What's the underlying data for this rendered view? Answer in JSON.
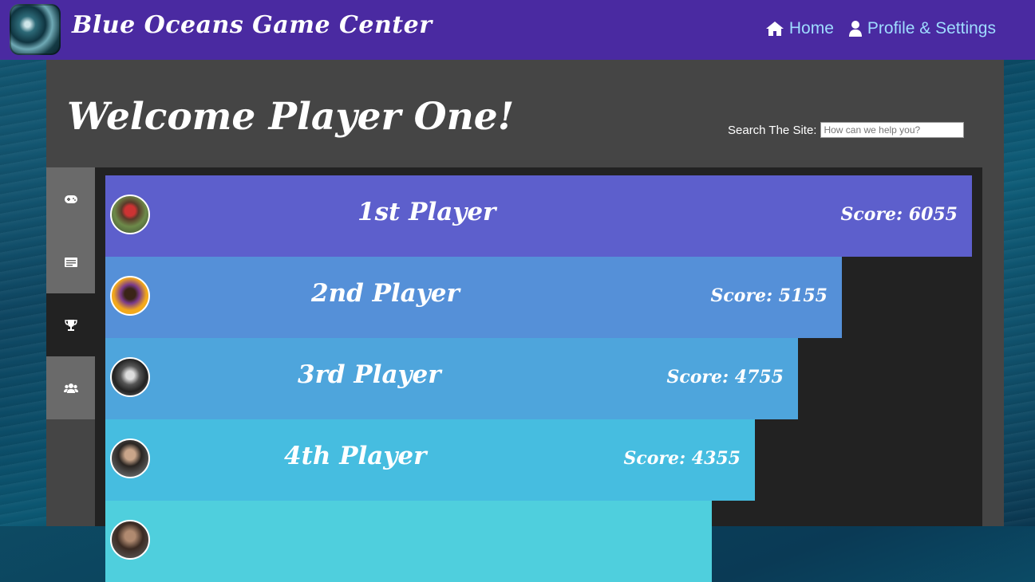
{
  "header": {
    "site_title": "Blue Oceans Game Center",
    "nav": [
      {
        "label": "Home",
        "icon": "home-icon"
      },
      {
        "label": "Profile & Settings",
        "icon": "user-icon"
      }
    ]
  },
  "main": {
    "welcome": "Welcome Player One!",
    "search_label": "Search The Site:",
    "search_placeholder": "How can we help you?"
  },
  "sidebar": {
    "items": [
      {
        "icon": "gamepad-icon",
        "active": false
      },
      {
        "icon": "news-icon",
        "active": false
      },
      {
        "icon": "trophy-icon",
        "active": true
      },
      {
        "icon": "users-icon",
        "active": false
      }
    ]
  },
  "leaderboard": {
    "rows": [
      {
        "name": "1st Player",
        "score": "Score: 6055",
        "color": "#5d5fcc"
      },
      {
        "name": "2nd Player",
        "score": "Score: 5155",
        "color": "#5590d8"
      },
      {
        "name": "3rd Player",
        "score": "Score: 4755",
        "color": "#4ea5dc"
      },
      {
        "name": "4th Player",
        "score": "Score: 4355",
        "color": "#46bde0"
      },
      {
        "name": "",
        "score": "",
        "color": "#4fcfdd"
      }
    ]
  },
  "colors": {
    "topbar": "#4a2aa1",
    "nav_link": "#9fdcff",
    "panel": "#454545"
  }
}
